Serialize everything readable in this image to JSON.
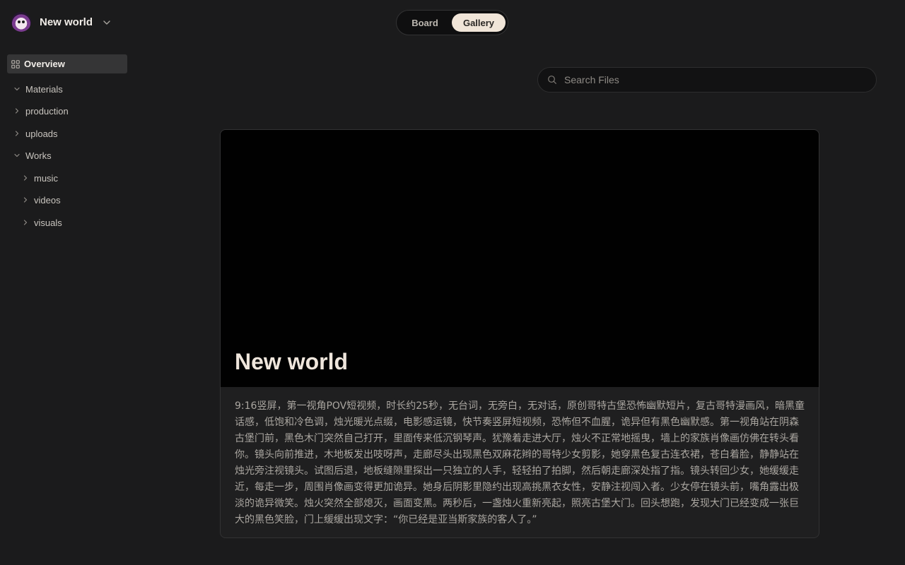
{
  "workspace": {
    "name": "New world",
    "avatar_icon": "avatar-icon",
    "switch_icon": "chevron-down-icon"
  },
  "sidebar": {
    "overview_label": "Overview",
    "tree": [
      {
        "label": "Materials",
        "expanded": true,
        "level": 0
      },
      {
        "label": "production",
        "expanded": false,
        "level": 1
      },
      {
        "label": "uploads",
        "expanded": false,
        "level": 1
      },
      {
        "label": "Works",
        "expanded": true,
        "level": 0
      },
      {
        "label": "music",
        "expanded": false,
        "level": 1
      },
      {
        "label": "videos",
        "expanded": false,
        "level": 1
      },
      {
        "label": "visuals",
        "expanded": false,
        "level": 1
      }
    ]
  },
  "view_toggle": {
    "board_label": "Board",
    "gallery_label": "Gallery",
    "active": "Gallery"
  },
  "search": {
    "placeholder": "Search Files",
    "value": ""
  },
  "card": {
    "title": "New world",
    "description": "9:16竖屏，第一视角POV短视频，时长约25秒，无台词，无旁白，无对话，原创哥特古堡恐怖幽默短片，复古哥特漫画风，暗黑童话感，低饱和冷色调，烛光暖光点缀，电影感运镜，快节奏竖屏短视频，恐怖但不血腥，诡异但有黑色幽默感。第一视角站在阴森古堡门前，黑色木门突然自己打开，里面传来低沉钢琴声。犹豫着走进大厅，烛火不正常地摇曳，墙上的家族肖像画仿佛在转头看你。镜头向前推进，木地板发出吱呀声，走廊尽头出现黑色双麻花辫的哥特少女剪影，她穿黑色复古连衣裙，苍白着脸，静静站在烛光旁注视镜头。试图后退，地板缝隙里探出一只独立的人手，轻轻拍了拍脚，然后朝走廊深处指了指。镜头转回少女，她缓缓走近，每走一步，周围肖像画变得更加诡异。她身后阴影里隐约出现高挑黑衣女性，安静注视闯入者。少女停在镜头前，嘴角露出极淡的诡异微笑。烛火突然全部熄灭，画面变黑。两秒后，一盏烛火重新亮起，照亮古堡大门。回头想跑，发现大门已经变成一张巨大的黑色笑脸，门上缓缓出现文字：“你已经是亚当斯家族的客人了。”"
  },
  "colors": {
    "background": "#1b1b1c",
    "accent": "#f0e5d8",
    "cover": "#010101"
  }
}
